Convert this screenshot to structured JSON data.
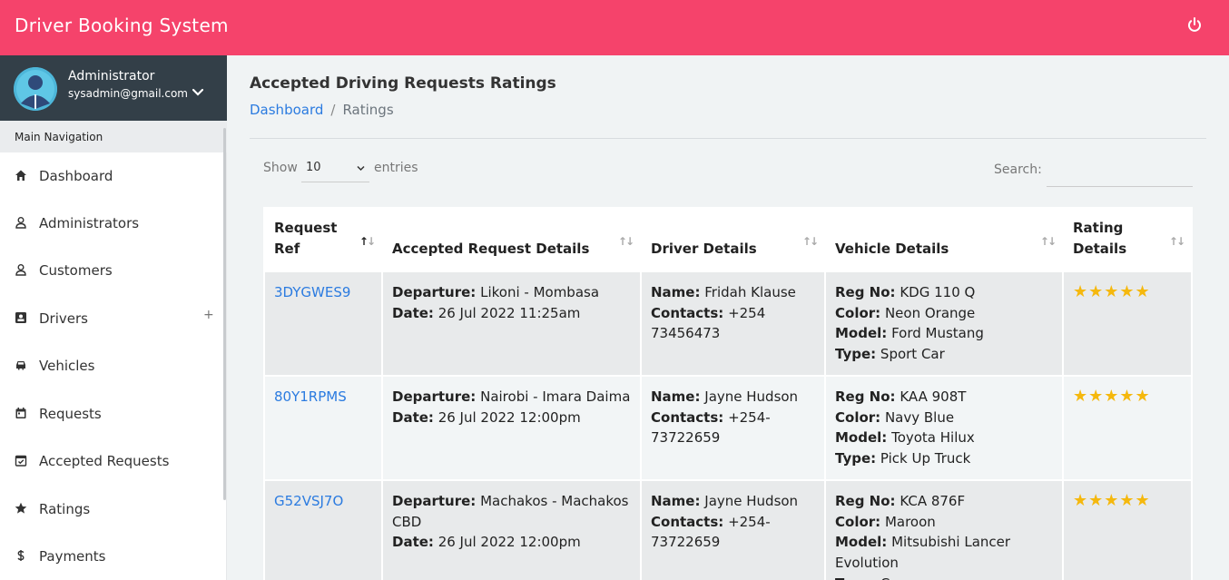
{
  "app": {
    "title": "Driver Booking System"
  },
  "user": {
    "name": "Administrator",
    "email": "sysadmin@gmail.com"
  },
  "nav": {
    "heading": "Main Navigation",
    "items": [
      {
        "label": "Dashboard",
        "icon": "home-icon"
      },
      {
        "label": "Administrators",
        "icon": "user-icon"
      },
      {
        "label": "Customers",
        "icon": "user-icon"
      },
      {
        "label": "Drivers",
        "icon": "id-card-icon",
        "expand": "+"
      },
      {
        "label": "Vehicles",
        "icon": "car-icon"
      },
      {
        "label": "Requests",
        "icon": "calendar-icon"
      },
      {
        "label": "Accepted Requests",
        "icon": "calendar-check-icon"
      },
      {
        "label": "Ratings",
        "icon": "star-icon"
      },
      {
        "label": "Payments",
        "icon": "dollar-icon"
      }
    ]
  },
  "page": {
    "title": "Accepted Driving Requests Ratings",
    "breadcrumb": {
      "home": "Dashboard",
      "sep": "/",
      "current": "Ratings"
    }
  },
  "table_controls": {
    "show": "Show",
    "entries_value": "10",
    "entries": "entries",
    "search_label": "Search:",
    "search_value": ""
  },
  "table": {
    "headers": {
      "ref_line1": "Request",
      "ref_line2": "Ref",
      "details": "Accepted Request Details",
      "driver": "Driver Details",
      "vehicle": "Vehicle Details",
      "rating_line1": "Rating",
      "rating_line2": "Details"
    },
    "field_labels": {
      "departure": "Departure:",
      "date": "Date:",
      "name": "Name:",
      "contacts": "Contacts:",
      "reg": "Reg No:",
      "color": "Color:",
      "model": "Model:",
      "type": "Type:"
    },
    "rows": [
      {
        "ref": "3DYGWES9",
        "departure": "Likoni - Mombasa",
        "date": "26 Jul 2022 11:25am",
        "driver_name": "Fridah Klause",
        "contacts": "+254 73456473",
        "reg": "KDG 110 Q",
        "color": "Neon Orange",
        "model": "Ford Mustang",
        "type": "Sport Car",
        "rating": 5,
        "stars": "★★★★★"
      },
      {
        "ref": "80Y1RPMS",
        "departure": "Nairobi - Imara Daima",
        "date": "26 Jul 2022 12:00pm",
        "driver_name": "Jayne Hudson",
        "contacts": "+254-73722659",
        "reg": "KAA 908T",
        "color": "Navy Blue",
        "model": "Toyota Hilux",
        "type": "Pick Up Truck",
        "rating": 5,
        "stars": "★★★★★"
      },
      {
        "ref": "G52VSJ7O",
        "departure": "Machakos - Machakos CBD",
        "date": "26 Jul 2022 12:00pm",
        "driver_name": "Jayne Hudson",
        "contacts": "+254-73722659",
        "reg": "KCA 876F",
        "color": "Maroon",
        "model": "Mitsubishi Lancer Evolution",
        "type": "Coupe",
        "rating": 5,
        "stars": "★★★★★"
      }
    ]
  },
  "colors": {
    "topbar": "#f5436b",
    "userbox": "#333f48",
    "link": "#2b7be0",
    "star": "#f5b80d"
  }
}
